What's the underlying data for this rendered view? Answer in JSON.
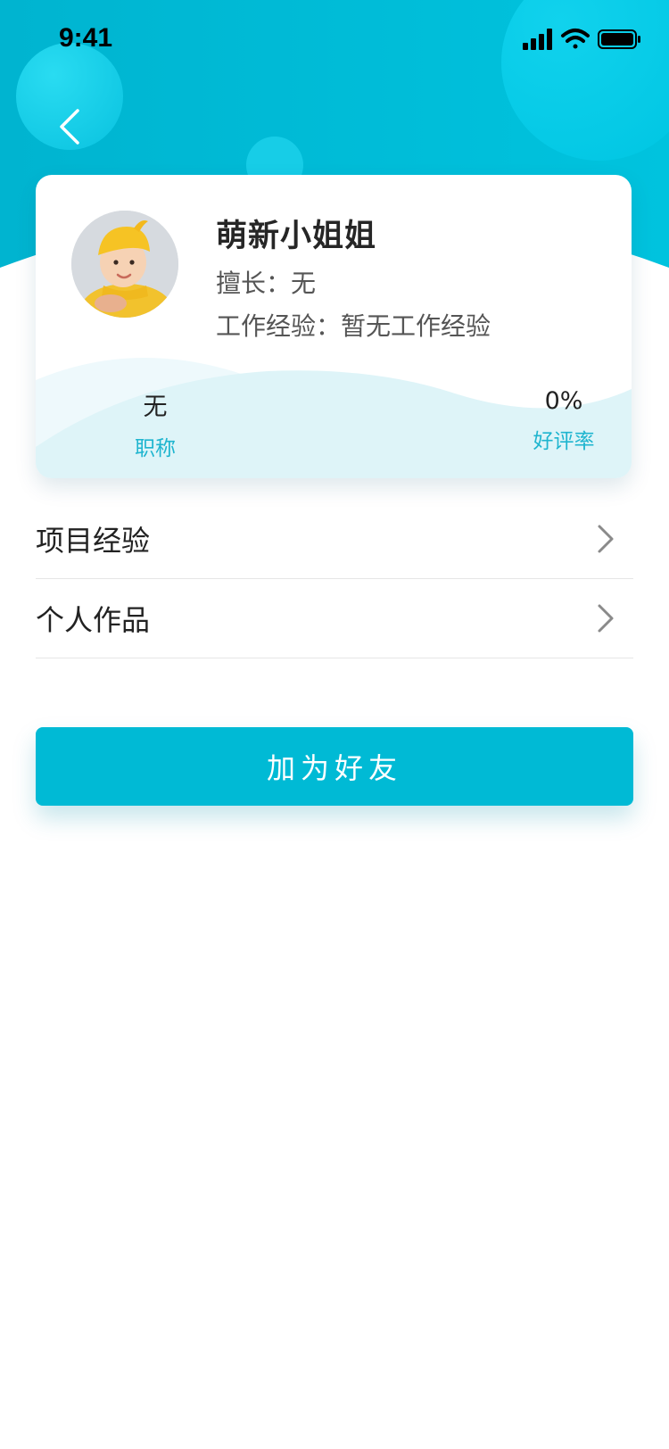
{
  "status_bar": {
    "time": "9:41"
  },
  "profile": {
    "name": "萌新小姐姐",
    "specialty_label": "擅长：",
    "specialty_value": "无",
    "experience_label": "工作经验：",
    "experience_value": "暂无工作经验",
    "stats": [
      {
        "value": "无",
        "label": "职称"
      },
      {
        "value": "0%",
        "label": "好评率"
      }
    ]
  },
  "menu": {
    "items": [
      {
        "label": "项目经验"
      },
      {
        "label": "个人作品"
      }
    ]
  },
  "actions": {
    "add_friend_label": "加为好友"
  },
  "colors": {
    "brand": "#00bad5",
    "header_bg": "#00b5d1",
    "stat_label": "#1fb5cf"
  }
}
